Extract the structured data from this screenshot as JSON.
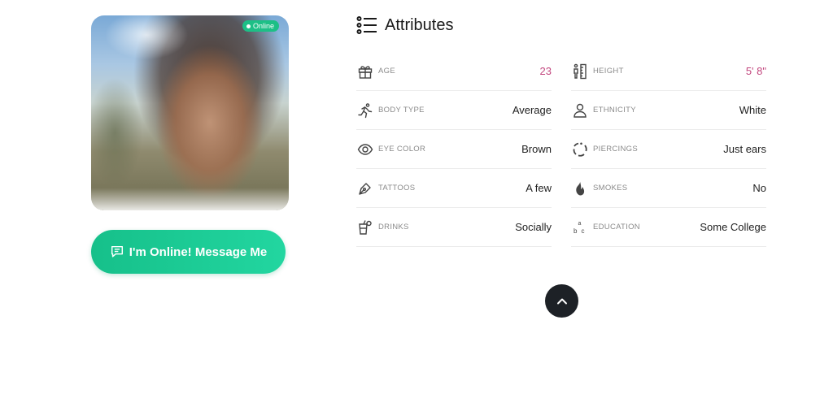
{
  "profile": {
    "online_badge": "Online",
    "message_button": "I'm Online! Message Me"
  },
  "attributes": {
    "title": "Attributes",
    "left": [
      {
        "label": "AGE",
        "value": "23",
        "icon": "gift-icon"
      },
      {
        "label": "BODY TYPE",
        "value": "Average",
        "icon": "running-icon"
      },
      {
        "label": "EYE COLOR",
        "value": "Brown",
        "icon": "eye-icon"
      },
      {
        "label": "TATTOOS",
        "value": "A few",
        "icon": "pen-nib-icon"
      },
      {
        "label": "DRINKS",
        "value": "Socially",
        "icon": "drinks-icon"
      }
    ],
    "right": [
      {
        "label": "HEIGHT",
        "value": "5' 8\"",
        "icon": "height-icon"
      },
      {
        "label": "ETHNICITY",
        "value": "White",
        "icon": "person-icon"
      },
      {
        "label": "PIERCINGS",
        "value": "Just ears",
        "icon": "ring-icon"
      },
      {
        "label": "SMOKES",
        "value": "No",
        "icon": "flame-icon"
      },
      {
        "label": "EDUCATION",
        "value": "Some College",
        "icon": "abc-icon"
      }
    ]
  },
  "colors": {
    "accent_value": "#c2467e",
    "online_green": "#1dbf86",
    "button_gradient_start": "#16c08a",
    "button_gradient_end": "#22d6a0",
    "scroll_button": "#1d2126"
  }
}
